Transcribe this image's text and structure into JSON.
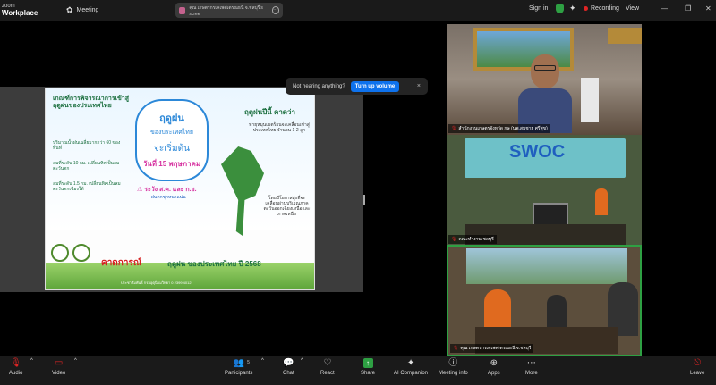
{
  "app": {
    "brand_top": "zoom",
    "brand_bottom": "Workplace"
  },
  "topbar": {
    "meeting_label": "Meeting",
    "share_title": "คุณ เกษตรกรเคเพศเตรณธนี จ.ชลบุรี's scree",
    "sign_in": "Sign in",
    "recording": "Recording",
    "view": "View",
    "colors": {
      "recording_dot": "#e02424",
      "shield": "#2ea043"
    }
  },
  "toast": {
    "message": "Not hearing anything?",
    "button": "Turn up volume",
    "close": "×"
  },
  "slide": {
    "left_heading": "เกณฑ์การพิจารณาการเข้าสู่ฤดูฝนของประเทศไทย",
    "bubble_line1": "ฤดูฝน",
    "bubble_line2": "ของประเทศไทย",
    "bubble_line3": "จะเริ่มต้น",
    "bubble_date": "วันที่ 15 พฤษภาคม",
    "right_heading": "ฤดูฝนปีนี้ คาดว่า",
    "right_text": "พายุหมุนเขตร้อนจะเคลื่อนเข้าสู่ประเทศไทย จำนวน 1-2 ลูก",
    "right_text2": "โดยมีโอกาสสูงที่จะเคลื่อนผ่านบริเวณภาคตะวันออกเฉียงเหนือและภาคเหนือ",
    "notes": [
      "ปริมาณน้ำฝนเฉลี่ยมากกว่า 60 ของพื้นที่",
      "ลมที่ระดับ 10 กม. เปลี่ยนทิศเป็นลมตะวันตก",
      "ลมที่ระดับ 1.5 กม. เปลี่ยนทิศเป็นลมตะวันตกเฉียงใต้"
    ],
    "warning": "ระวัง ส.ค. และ ก.ย.",
    "warning2": "ฝนตกชุกหนาแน่น",
    "footer_red": "คาดการณ์",
    "footer_green": "ฤดูฝน ของประเทศไทย ปี 2568",
    "contact": "ประชาสัมพันธ์ กรมอุตุนิยมวิทยา 0 2399 4012"
  },
  "participants": [
    {
      "name": "สำนักงานเกษตรจังหวัด กษ (นพ.สมชาย ศรีสุข)",
      "muted": true
    },
    {
      "name": "คณะทำงาน-ชลบุรี",
      "muted": true
    },
    {
      "name": "คุณ เกษตรกรเคเพศเตรณธนี จ.ชลบุรี",
      "muted": true
    }
  ],
  "toolbar": {
    "audio": "Audio",
    "video": "Video",
    "participants": "Participants",
    "participants_count": "5",
    "chat": "Chat",
    "react": "React",
    "share": "Share",
    "ai_companion": "AI Companion",
    "meeting_info": "Meeting info",
    "apps": "Apps",
    "more": "More",
    "leave": "Leave"
  }
}
